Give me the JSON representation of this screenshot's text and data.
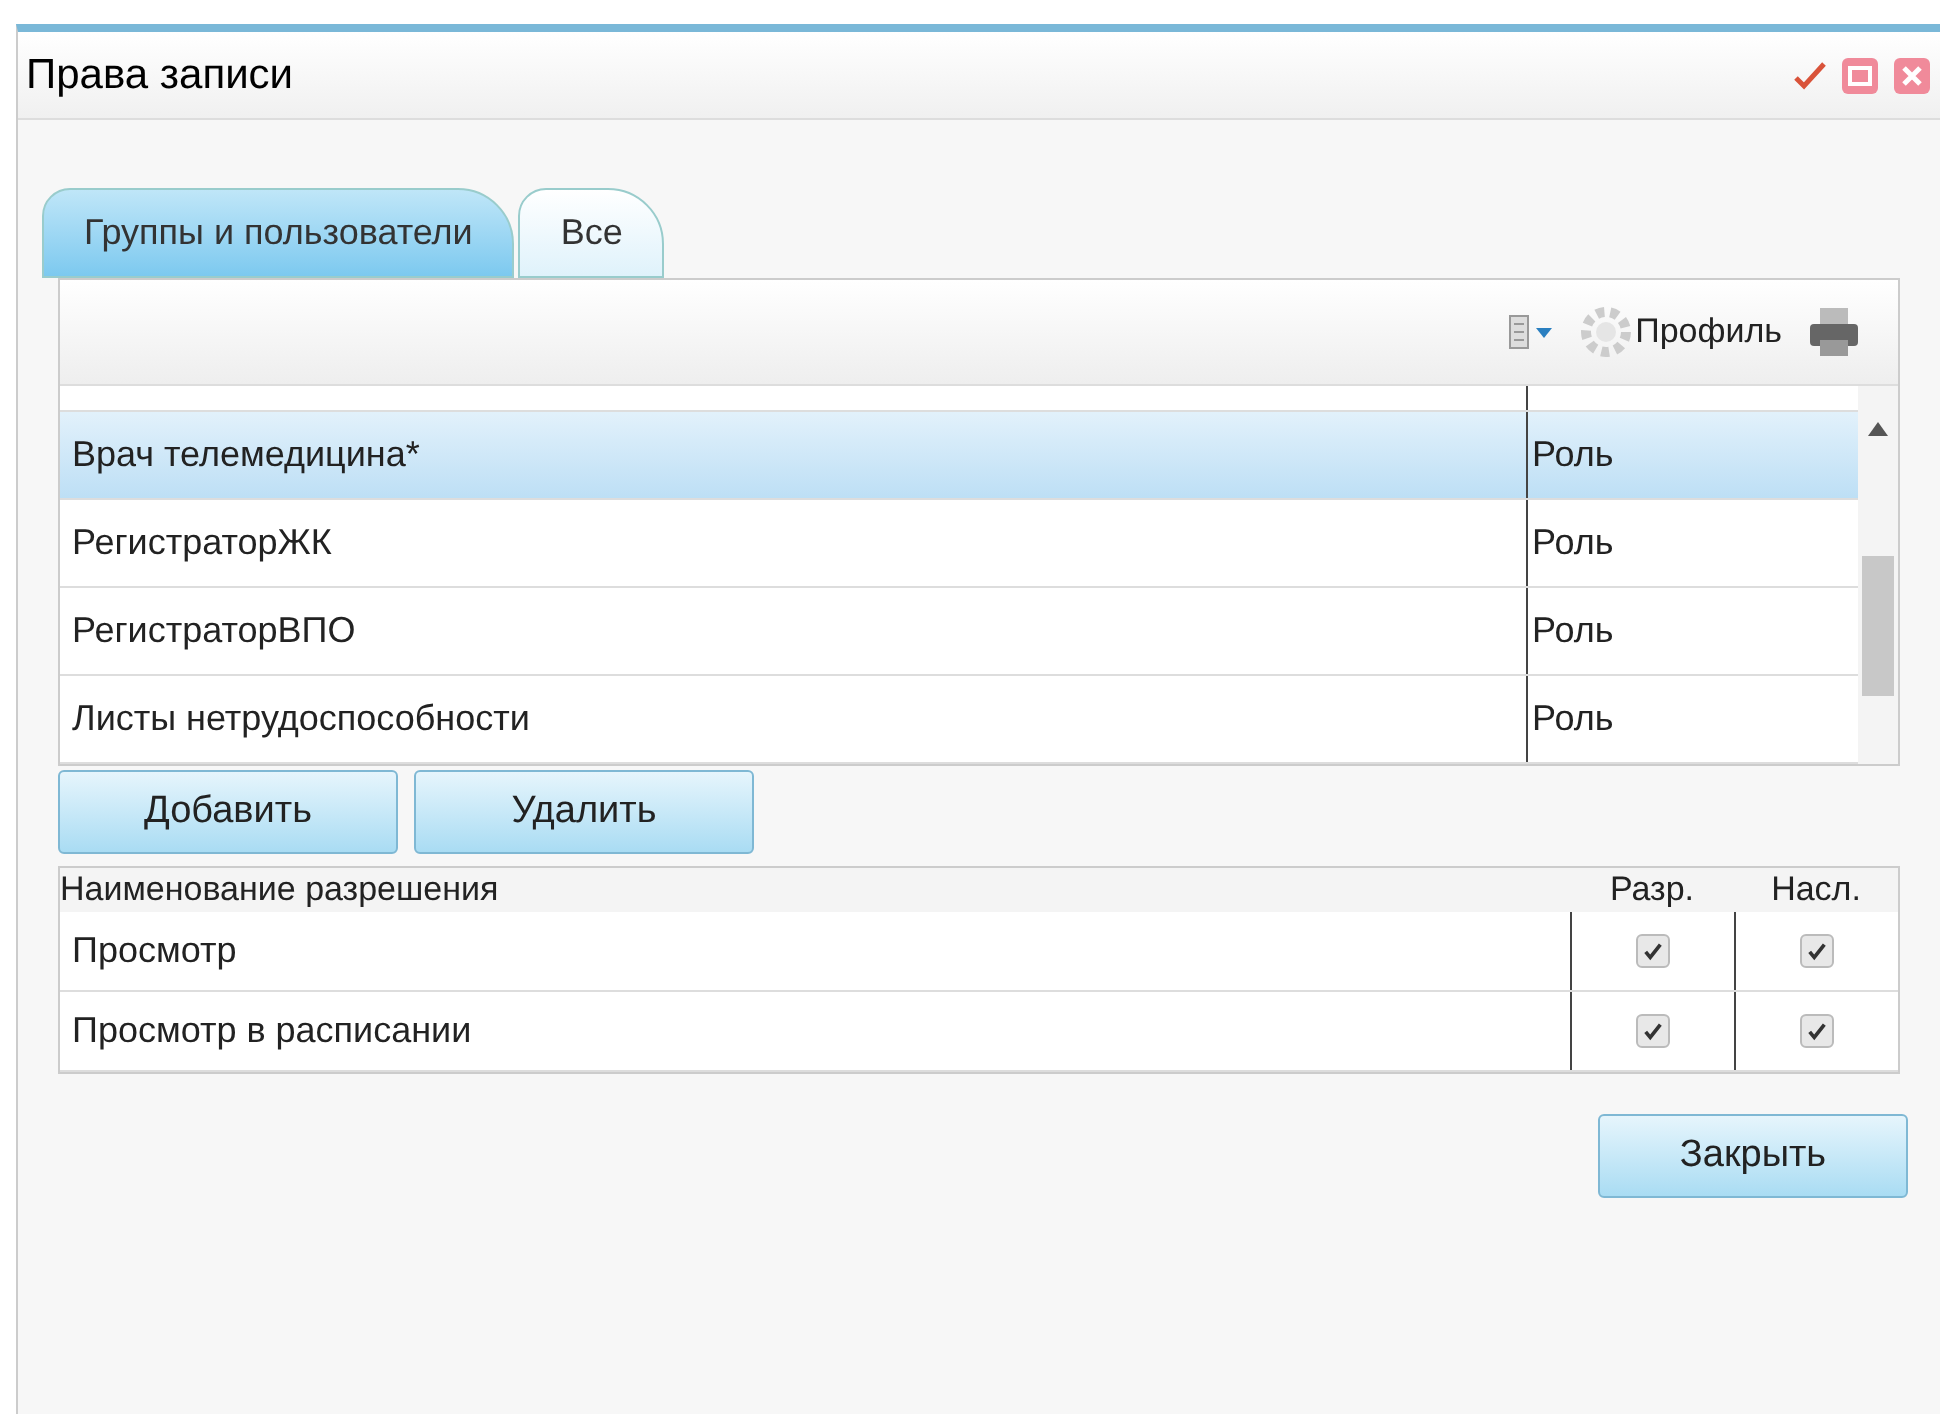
{
  "window": {
    "title": "Права записи"
  },
  "tabs": [
    {
      "label": "Группы и пользователи",
      "selected": true
    },
    {
      "label": "Все",
      "selected": false
    }
  ],
  "toolbar": {
    "profile_label": "Профиль"
  },
  "roles": [
    {
      "name": "Врач телемедицина*",
      "type": "Роль",
      "selected": true
    },
    {
      "name": "РегистраторЖК",
      "type": "Роль",
      "selected": false
    },
    {
      "name": "РегистраторВПО",
      "type": "Роль",
      "selected": false
    },
    {
      "name": "Листы нетрудоспособности",
      "type": "Роль",
      "selected": false
    }
  ],
  "role_buttons": [
    "Добавить",
    "Удалить"
  ],
  "permissions": {
    "columns": [
      "Наименование разрешения",
      "Разр.",
      "Насл."
    ],
    "rows": [
      {
        "name": "Просмотр",
        "allowed": true,
        "inherited": true
      },
      {
        "name": "Просмотр в расписании",
        "allowed": true,
        "inherited": true
      }
    ]
  },
  "close_button": "Закрыть"
}
